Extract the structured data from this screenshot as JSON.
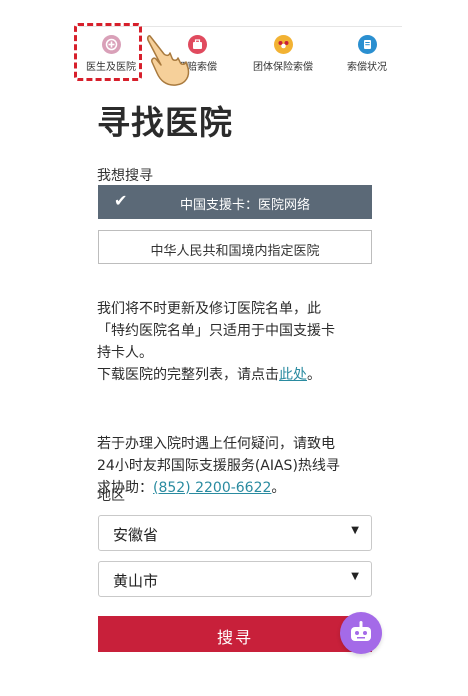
{
  "nav": {
    "items": [
      {
        "label": "医生及医院",
        "icon": "hospital-icon"
      },
      {
        "label": "理赔索偿",
        "icon": "briefcase-icon"
      },
      {
        "label": "团体保险索偿",
        "icon": "group-icon"
      },
      {
        "label": "索偿状况",
        "icon": "document-icon"
      }
    ]
  },
  "page": {
    "title": "寻找医院",
    "search_label": "我想搜寻",
    "option_selected": "中国支援卡：医院网络",
    "option_other": "中华人民共和国境内指定医院",
    "para1_line1": "我们将不时更新及修订医院名单，此",
    "para1_line2": "「特约医院名单」只适用于中国支援卡",
    "para1_line3": "持卡人。",
    "para1_line4_prefix": "下载医院的完整列表，请点击",
    "para1_link": "此处",
    "para1_line4_suffix": "。",
    "para2_line1": "若于办理入院时遇上任何疑问，请致电",
    "para2_line2": "24小时友邦国际支援服务(AIAS)热线寻",
    "para2_line3_prefix": "求协助：",
    "para2_phone": "(852) 2200-6622",
    "para2_line3_suffix": "。",
    "region_label": "地区",
    "province": "安徽省",
    "city": "黄山市",
    "search_button": "搜寻"
  },
  "colors": {
    "accent_red": "#c8203a",
    "selected_option_bg": "#5b6977",
    "link": "#2a8ba0",
    "chatbot": "#a46ae8",
    "highlight_dash": "#d71f2b"
  }
}
